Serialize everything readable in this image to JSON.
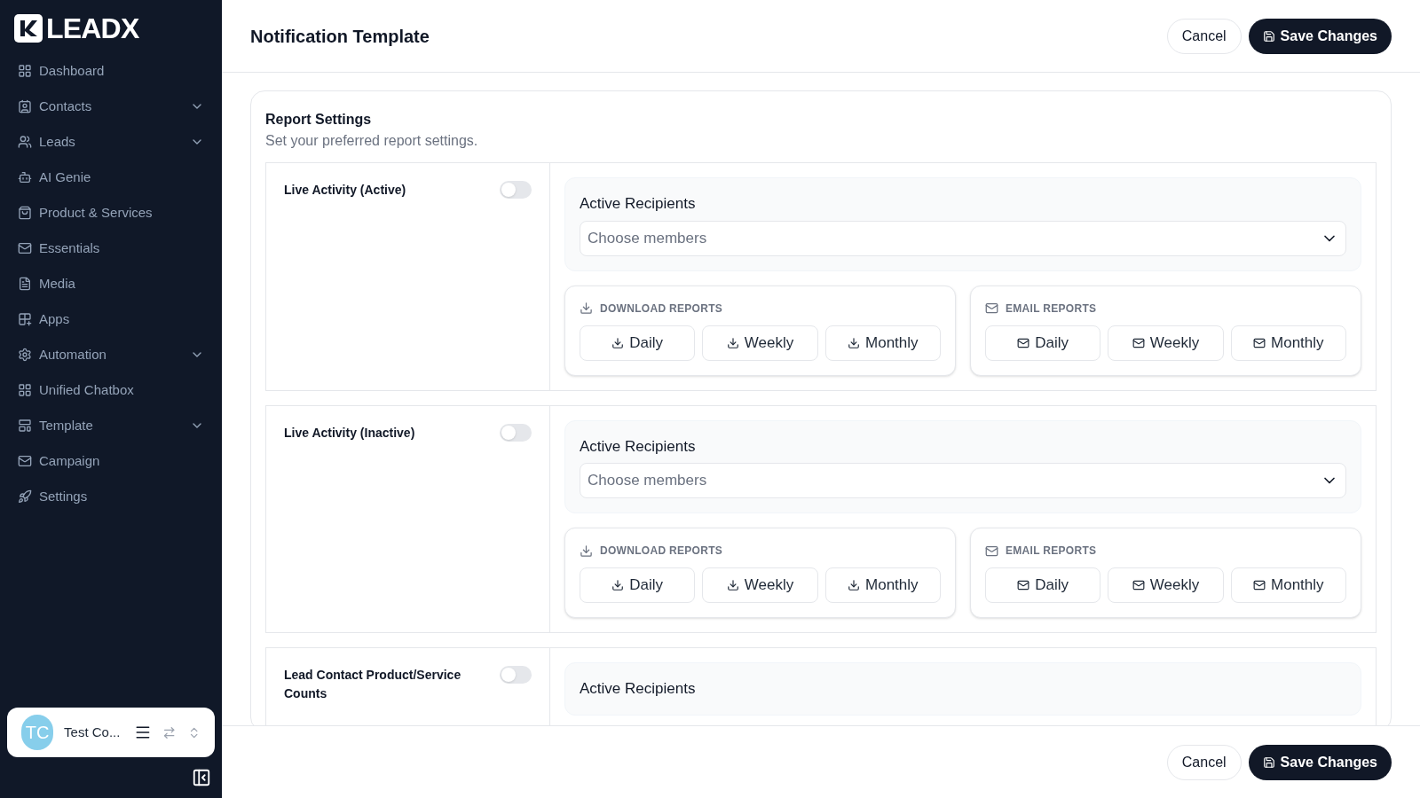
{
  "brand": "LEADX",
  "nav": [
    {
      "label": "Dashboard",
      "has_submenu": false
    },
    {
      "label": "Contacts",
      "has_submenu": true
    },
    {
      "label": "Leads",
      "has_submenu": true
    },
    {
      "label": "AI Genie",
      "has_submenu": false
    },
    {
      "label": "Product & Services",
      "has_submenu": false
    },
    {
      "label": "Essentials",
      "has_submenu": false
    },
    {
      "label": "Media",
      "has_submenu": false
    },
    {
      "label": "Apps",
      "has_submenu": false
    },
    {
      "label": "Automation",
      "has_submenu": true
    },
    {
      "label": "Unified Chatbox",
      "has_submenu": false
    },
    {
      "label": "Template",
      "has_submenu": true
    },
    {
      "label": "Campaign",
      "has_submenu": false
    },
    {
      "label": "Settings",
      "has_submenu": false
    }
  ],
  "user": {
    "initials": "TC",
    "name": "Test Co..."
  },
  "page_title": "Notification Template",
  "header_buttons": {
    "cancel": "Cancel",
    "save": "Save Changes"
  },
  "card": {
    "title": "Report Settings",
    "subtitle": "Set your preferred report settings."
  },
  "sections": [
    {
      "title": "Live Activity (Active)",
      "on": false,
      "recipients_label": "Active Recipients",
      "placeholder": "Choose members",
      "groups": [
        {
          "kind": "download",
          "label": "DOWNLOAD REPORTS",
          "buttons": [
            "Daily",
            "Weekly",
            "Monthly"
          ]
        },
        {
          "kind": "email",
          "label": "EMAIL REPORTS",
          "buttons": [
            "Daily",
            "Weekly",
            "Monthly"
          ]
        }
      ]
    },
    {
      "title": "Live Activity (Inactive)",
      "on": false,
      "recipients_label": "Active Recipients",
      "placeholder": "Choose members",
      "groups": [
        {
          "kind": "download",
          "label": "DOWNLOAD REPORTS",
          "buttons": [
            "Daily",
            "Weekly",
            "Monthly"
          ]
        },
        {
          "kind": "email",
          "label": "EMAIL REPORTS",
          "buttons": [
            "Daily",
            "Weekly",
            "Monthly"
          ]
        }
      ]
    },
    {
      "title": "Lead Contact Product/Service Counts",
      "on": false,
      "recipients_label": "Active Recipients"
    }
  ],
  "footer_buttons": {
    "cancel": "Cancel",
    "save": "Save Changes"
  }
}
